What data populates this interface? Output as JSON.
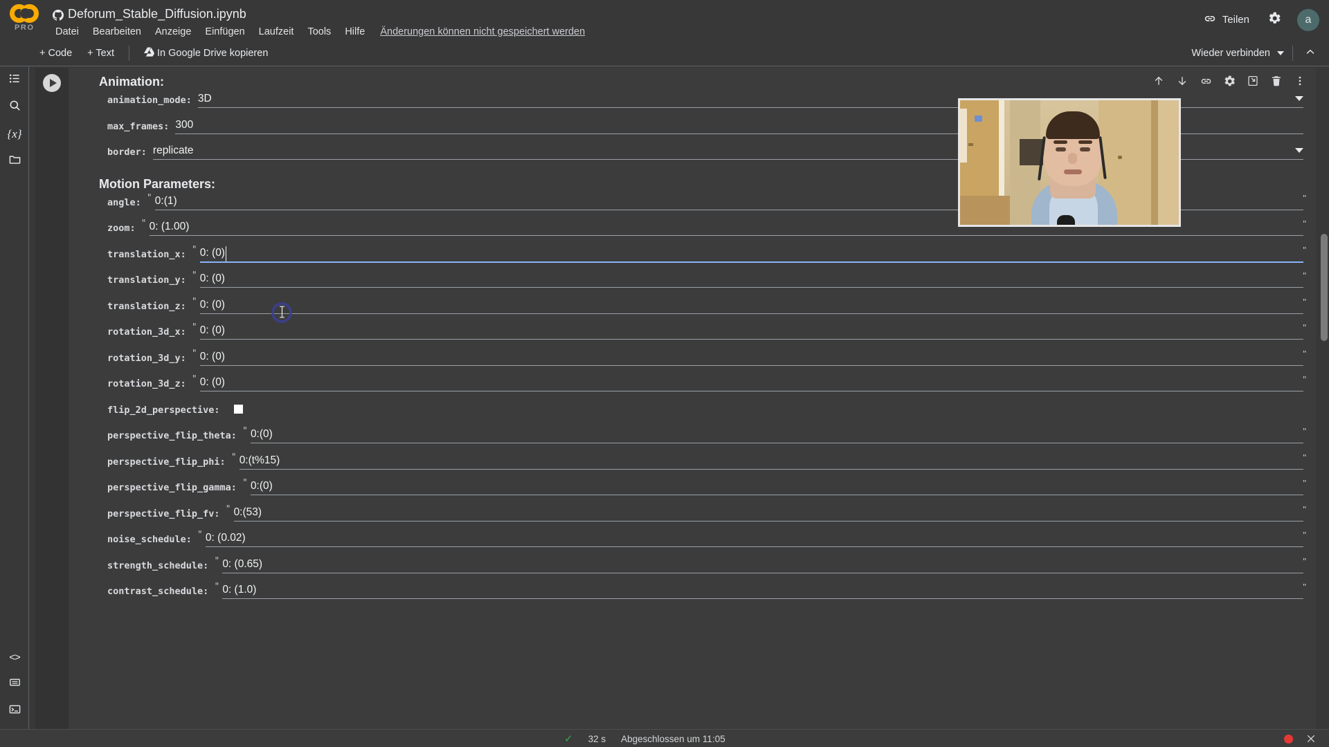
{
  "header": {
    "logo_text": "PRO",
    "github_icon": "github-icon",
    "notebook_title": "Deforum_Stable_Diffusion.ipynb",
    "menu": [
      "Datei",
      "Bearbeiten",
      "Anzeige",
      "Einfügen",
      "Laufzeit",
      "Tools",
      "Hilfe"
    ],
    "save_note": "Änderungen können nicht gespeichert werden",
    "share_label": "Teilen",
    "share_icon": "link-icon",
    "settings_icon": "gear-icon",
    "avatar_initial": "a"
  },
  "toolbar": {
    "add_code_label": "+ Code",
    "add_text_label": "+ Text",
    "copy_drive_label": "In Google Drive kopieren",
    "drive_icon": "google-drive-icon",
    "reconnect_label": "Wieder verbinden",
    "collapse_icon": "chevron-up-icon"
  },
  "sidebar": {
    "items": [
      {
        "name": "table-of-contents",
        "icon": "list-icon"
      },
      {
        "name": "search",
        "icon": "search-icon"
      },
      {
        "name": "variables",
        "icon": "variables-icon",
        "glyph": "{x}"
      },
      {
        "name": "files",
        "icon": "folder-icon"
      }
    ],
    "bottom_items": [
      {
        "name": "code-snippets",
        "icon": "code-brackets-icon",
        "glyph": "<>"
      },
      {
        "name": "command-palette",
        "icon": "command-palette-icon"
      },
      {
        "name": "terminal",
        "icon": "terminal-icon"
      }
    ]
  },
  "cell": {
    "run_icon": "play-icon",
    "tools": [
      {
        "name": "move-cell-up",
        "icon": "arrow-up-icon"
      },
      {
        "name": "move-cell-down",
        "icon": "arrow-down-icon"
      },
      {
        "name": "copy-cell-link",
        "icon": "link-icon"
      },
      {
        "name": "cell-settings",
        "icon": "gear-icon"
      },
      {
        "name": "mirror-cell",
        "icon": "mirror-cell-icon"
      },
      {
        "name": "delete-cell",
        "icon": "trash-icon"
      },
      {
        "name": "more-cell-actions",
        "icon": "more-vertical-icon"
      }
    ]
  },
  "form": {
    "section_animation": "Animation:",
    "section_motion": "Motion Parameters:",
    "fields": [
      {
        "label": "animation_mode:",
        "value": "3D",
        "type": "dropdown",
        "quoted": false
      },
      {
        "label": "max_frames:",
        "value": "300",
        "type": "text",
        "quoted": false
      },
      {
        "label": "border:",
        "value": "replicate",
        "type": "dropdown",
        "quoted": false
      },
      {
        "label": "angle:",
        "value": "0:(1)",
        "type": "text",
        "quoted": true
      },
      {
        "label": "zoom:",
        "value": "0: (1.00)",
        "type": "text",
        "quoted": true
      },
      {
        "label": "translation_x:",
        "value": "0: (0)",
        "type": "text",
        "quoted": true,
        "focused": true
      },
      {
        "label": "translation_y:",
        "value": "0: (0)",
        "type": "text",
        "quoted": true
      },
      {
        "label": "translation_z:",
        "value": "0: (0)",
        "type": "text",
        "quoted": true
      },
      {
        "label": "rotation_3d_x:",
        "value": "0: (0)",
        "type": "text",
        "quoted": true
      },
      {
        "label": "rotation_3d_y:",
        "value": "0: (0)",
        "type": "text",
        "quoted": true
      },
      {
        "label": "rotation_3d_z:",
        "value": "0: (0)",
        "type": "text",
        "quoted": true
      },
      {
        "label": "flip_2d_perspective:",
        "value": "",
        "type": "checkbox",
        "quoted": false,
        "checked": false
      },
      {
        "label": "perspective_flip_theta:",
        "value": "0:(0)",
        "type": "text",
        "quoted": true
      },
      {
        "label": "perspective_flip_phi:",
        "value": "0:(t%15)",
        "type": "text",
        "quoted": true
      },
      {
        "label": "perspective_flip_gamma:",
        "value": "0:(0)",
        "type": "text",
        "quoted": true
      },
      {
        "label": "perspective_flip_fv:",
        "value": "0:(53)",
        "type": "text",
        "quoted": true
      },
      {
        "label": "noise_schedule:",
        "value": "0: (0.02)",
        "type": "text",
        "quoted": true
      },
      {
        "label": "strength_schedule:",
        "value": "0: (0.65)",
        "type": "text",
        "quoted": true
      },
      {
        "label": "contrast_schedule:",
        "value": "0: (1.0)",
        "type": "text",
        "quoted": true
      }
    ],
    "quote_char": "\""
  },
  "status": {
    "check_icon": "check-icon",
    "duration": "32 s",
    "completed_text": "Abgeschlossen um 11:05",
    "record_indicator": "recording-dot",
    "close_icon": "close-icon"
  },
  "colors": {
    "background": "#383838",
    "cell_background": "#3c3c3c",
    "accent_blue": "#8ab4f8",
    "logo_yellow": "#f9ab00",
    "success_green": "#34a853",
    "record_red": "#e53935"
  }
}
